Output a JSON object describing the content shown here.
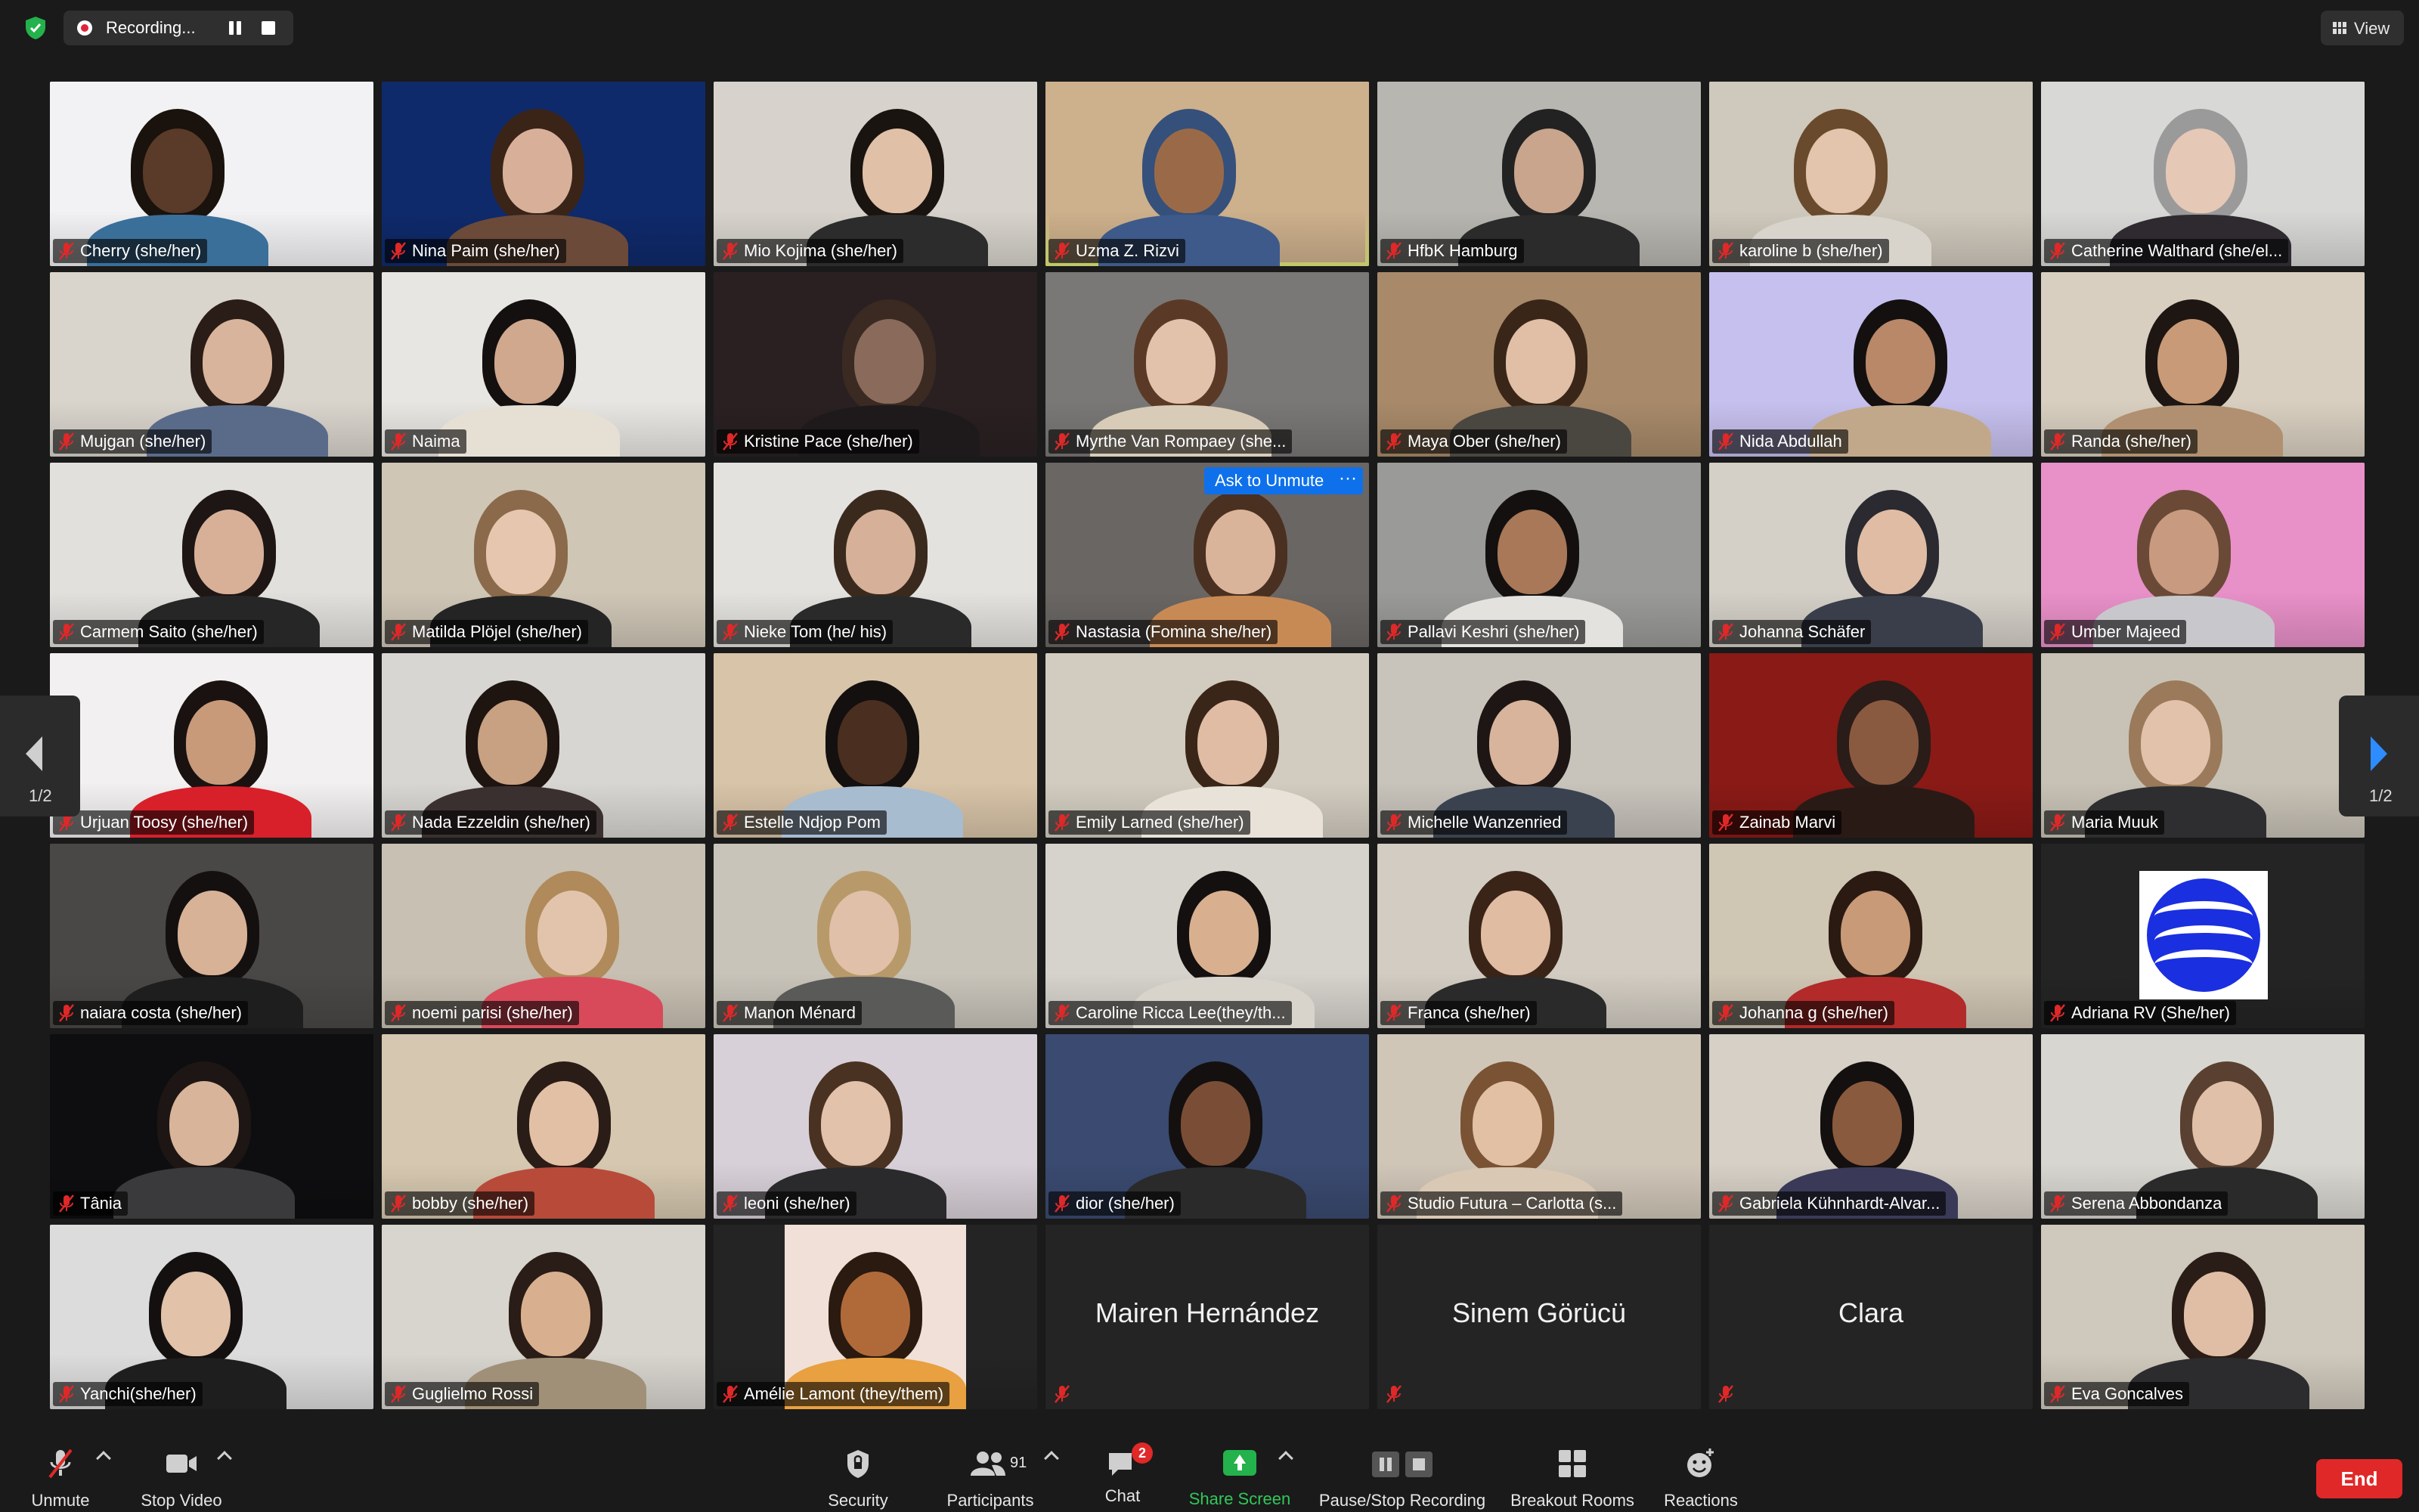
{
  "recording": {
    "label": "Recording...",
    "accent": "#e0243a"
  },
  "view": {
    "label": "View"
  },
  "participants": [
    {
      "name": "Cherry (she/her)",
      "bg": "#f2f2f4",
      "skin": "#5a3a28",
      "shirt": "#3a6f9a",
      "hair": "#1a120c"
    },
    {
      "name": "Nina Paim (she/her)",
      "bg": "#0f2a6b",
      "skin": "#d8b09a",
      "shirt": "#6b4a3a",
      "hair": "#3a2418"
    },
    {
      "name": "Mio Kojima (she/her)",
      "bg": "#d7d3cc",
      "skin": "#e1c0a8",
      "shirt": "#2c2c2c",
      "hair": "#1a1410"
    },
    {
      "name": "Uzma Z. Rizvi",
      "bg": "#cdb08c",
      "skin": "#9a6a48",
      "shirt": "#3e5a8a",
      "hair": "#35507a"
    },
    {
      "name": "HfbK Hamburg",
      "bg": "#b8b6b0",
      "skin": "#c8a58c",
      "shirt": "#2b2b2b",
      "hair": "#222"
    },
    {
      "name": "karoline b (she/her)",
      "bg": "#cfc8bc",
      "skin": "#e3c4ad",
      "shirt": "#d8d4cc",
      "hair": "#6a4a2c"
    },
    {
      "name": "Catherine Walthard (she/el...",
      "bg": "#d8d8d6",
      "skin": "#e6c8b6",
      "shirt": "#2e2a30",
      "hair": "#9a9a9a"
    },
    {
      "name": "Mujgan (she/her)",
      "bg": "#d9d4cc",
      "skin": "#d8b49c",
      "shirt": "#5a6b8a",
      "hair": "#2a1c16"
    },
    {
      "name": "Naima",
      "bg": "#e8e6e2",
      "skin": "#d0a88e",
      "shirt": "#e6e0d4",
      "hair": "#141010"
    },
    {
      "name": "Kristine Pace (she/her)",
      "bg": "#2a2022",
      "skin": "#8a6a5a",
      "shirt": "#1e1a1c",
      "hair": "#3a2a22"
    },
    {
      "name": "Myrthe Van Rompaey (she...",
      "bg": "#7a7876",
      "skin": "#e2c2aa",
      "shirt": "#d8ccb8",
      "hair": "#5a3a26"
    },
    {
      "name": "Maya Ober (she/her)",
      "bg": "#a88a6a",
      "skin": "#e0bfa6",
      "shirt": "#4a4640",
      "hair": "#3a2618"
    },
    {
      "name": "Nida Abdullah",
      "bg": "#c6c0ee",
      "skin": "#b88868",
      "shirt": "#c2a88a",
      "hair": "#141010"
    },
    {
      "name": "Randa (she/her)",
      "bg": "#d8cfc0",
      "skin": "#c89a78",
      "shirt": "#b09070",
      "hair": "#1e1612"
    },
    {
      "name": "Carmem Saito (she/her)",
      "bg": "#e2e0dc",
      "skin": "#d8b098",
      "shirt": "#262626",
      "hair": "#1e1614"
    },
    {
      "name": "Matilda Plöjel (she/her)",
      "bg": "#cfc6b6",
      "skin": "#e6c6ae",
      "shirt": "#242424",
      "hair": "#8a6a4a"
    },
    {
      "name": "Nieke Tom (he/ his)",
      "bg": "#e4e2de",
      "skin": "#d6b098",
      "shirt": "#2a2a2a",
      "hair": "#3a2a1e"
    },
    {
      "name": "Nastasia (Fomina she/her)",
      "bg": "#6a6664",
      "skin": "#dab49a",
      "shirt": "#c88a54",
      "hair": "#4a3020"
    },
    {
      "name": "Pallavi Keshri (she/her)",
      "bg": "#9a9a98",
      "skin": "#a87858",
      "shirt": "#e4e2de",
      "hair": "#141010"
    },
    {
      "name": "Johanna Schäfer",
      "bg": "#d4d0c8",
      "skin": "#e0bca4",
      "shirt": "#3a3e4a",
      "hair": "#2a2a30"
    },
    {
      "name": "Umber Majeed",
      "bg": "#e890c8",
      "skin": "#c89a80",
      "shirt": "#c8c8cc",
      "hair": "#6a4a36"
    },
    {
      "name": "Urjuan Toosy (she/her)",
      "bg": "#f2f0f0",
      "skin": "#c89a7a",
      "shirt": "#d8202a",
      "hair": "#1a1210"
    },
    {
      "name": "Nada Ezzeldin (she/her)",
      "bg": "#d8d6d2",
      "skin": "#c8a082",
      "shirt": "#3a3030",
      "hair": "#1e1410"
    },
    {
      "name": "Estelle Ndjop Pom",
      "bg": "#d8c4a8",
      "skin": "#4a2e20",
      "shirt": "#a8bcd0",
      "hair": "#141010"
    },
    {
      "name": "Emily Larned (she/her)",
      "bg": "#d2ccc0",
      "skin": "#e0bca4",
      "shirt": "#e8e2d8",
      "hair": "#3a2618"
    },
    {
      "name": "Michelle Wanzenried",
      "bg": "#c8c4bc",
      "skin": "#d8b49c",
      "shirt": "#3a4250",
      "hair": "#1e1614"
    },
    {
      "name": "Zainab Marvi",
      "bg": "#8a1a16",
      "skin": "#8a5a40",
      "shirt": "#2a1a16",
      "hair": "#2a1c18"
    },
    {
      "name": "Maria Muuk",
      "bg": "#c8c2b6",
      "skin": "#e2c2aa",
      "shirt": "#2e2e30",
      "hair": "#9a7a5a"
    },
    {
      "name": "naiara costa (she/her)",
      "bg": "#4a4846",
      "skin": "#d8b296",
      "shirt": "#1e1e1e",
      "hair": "#141010"
    },
    {
      "name": "noemi parisi (she/her)",
      "bg": "#c8c0b2",
      "skin": "#e2c4ac",
      "shirt": "#d84a5a",
      "hair": "#b08a5a"
    },
    {
      "name": "Manon Ménard",
      "bg": "#c8c4ba",
      "skin": "#e0c0a8",
      "shirt": "#5a5a58",
      "hair": "#b89a6a"
    },
    {
      "name": "Caroline Ricca Lee(they/th...",
      "bg": "#d6d2cc",
      "skin": "#d8b090",
      "shirt": "#d8d4cc",
      "hair": "#141010"
    },
    {
      "name": "Franca (she/her)",
      "bg": "#d2ccc2",
      "skin": "#e0bca2",
      "shirt": "#2a2a2a",
      "hair": "#3a2418"
    },
    {
      "name": "Johanna g (she/her)",
      "bg": "#d0c6b4",
      "skin": "#c89a78",
      "shirt": "#b22a2a",
      "hair": "#2a1a12"
    },
    {
      "name": "Adriana RV (She/her)",
      "bg": "#242424",
      "skin": "#242424",
      "shirt": "#242424",
      "hair": "#242424",
      "logo": true
    },
    {
      "name": "Tânia",
      "bg": "#0e0e10",
      "skin": "#d8b49a",
      "shirt": "#3a3a3c",
      "hair": "#1e1614"
    },
    {
      "name": "bobby (she/her)",
      "bg": "#d6c8b0",
      "skin": "#e2c0a6",
      "shirt": "#b84a3a",
      "hair": "#2a1c16"
    },
    {
      "name": "leoni (she/her)",
      "bg": "#d8d0d8",
      "skin": "#e2c2aa",
      "shirt": "#2a2a2c",
      "hair": "#4a3222"
    },
    {
      "name": "dior (she/her)",
      "bg": "#3a4a70",
      "skin": "#7a4e36",
      "shirt": "#2a2a2a",
      "hair": "#141010"
    },
    {
      "name": "Studio Futura – Carlotta (s...",
      "bg": "#d0c6b8",
      "skin": "#e2c0a4",
      "shirt": "#d8c8b4",
      "hair": "#7a5234"
    },
    {
      "name": "Gabriela Kühnhardt-Alvar...",
      "bg": "#d6d0c6",
      "skin": "#8a5a3e",
      "shirt": "#3a3a58",
      "hair": "#141010"
    },
    {
      "name": "Serena Abbondanza",
      "bg": "#d8d6d0",
      "skin": "#e0c0a8",
      "shirt": "#2a2a2a",
      "hair": "#5a4030"
    },
    {
      "name": "Yanchi(she/her)",
      "bg": "#dcdcdc",
      "skin": "#e2c2a8",
      "shirt": "#1e1e1e",
      "hair": "#141010"
    },
    {
      "name": "Guglielmo Rossi",
      "bg": "#d8d4ce",
      "skin": "#d8b090",
      "shirt": "#a09078",
      "hair": "#2a1c16"
    },
    {
      "name": "Amélie Lamont (they/them)",
      "bg": "#242424",
      "skin": "#b06a3a",
      "shirt": "#e8a040",
      "hair": "#2a1a10",
      "avatar": true
    },
    {
      "name": "Mairen Hernández",
      "novideo": true
    },
    {
      "name": "Sinem Görücü",
      "novideo": true
    },
    {
      "name": "Clara",
      "novideo": true
    },
    {
      "name": "Eva Goncalves",
      "bg": "#cfc8bc",
      "skin": "#e0bea6",
      "shirt": "#2c2c2e",
      "hair": "#2a1c16"
    }
  ],
  "ask_to_unmute": {
    "label": "Ask to Unmute",
    "more": "···"
  },
  "pager": {
    "left": "1/2",
    "right": "1/2"
  },
  "toolbar": {
    "unmute": "Unmute",
    "stop_video": "Stop Video",
    "security": "Security",
    "participants": "Participants",
    "participants_count": "91",
    "chat": "Chat",
    "chat_badge": "2",
    "share_screen": "Share Screen",
    "pause_stop_recording": "Pause/Stop Recording",
    "breakout_rooms": "Breakout Rooms",
    "reactions": "Reactions",
    "end": "End"
  },
  "colors": {
    "accent_blue": "#0e71eb",
    "share_green": "#23b24b",
    "end_red": "#e02828",
    "active_speaker": "#e2eb7c"
  }
}
